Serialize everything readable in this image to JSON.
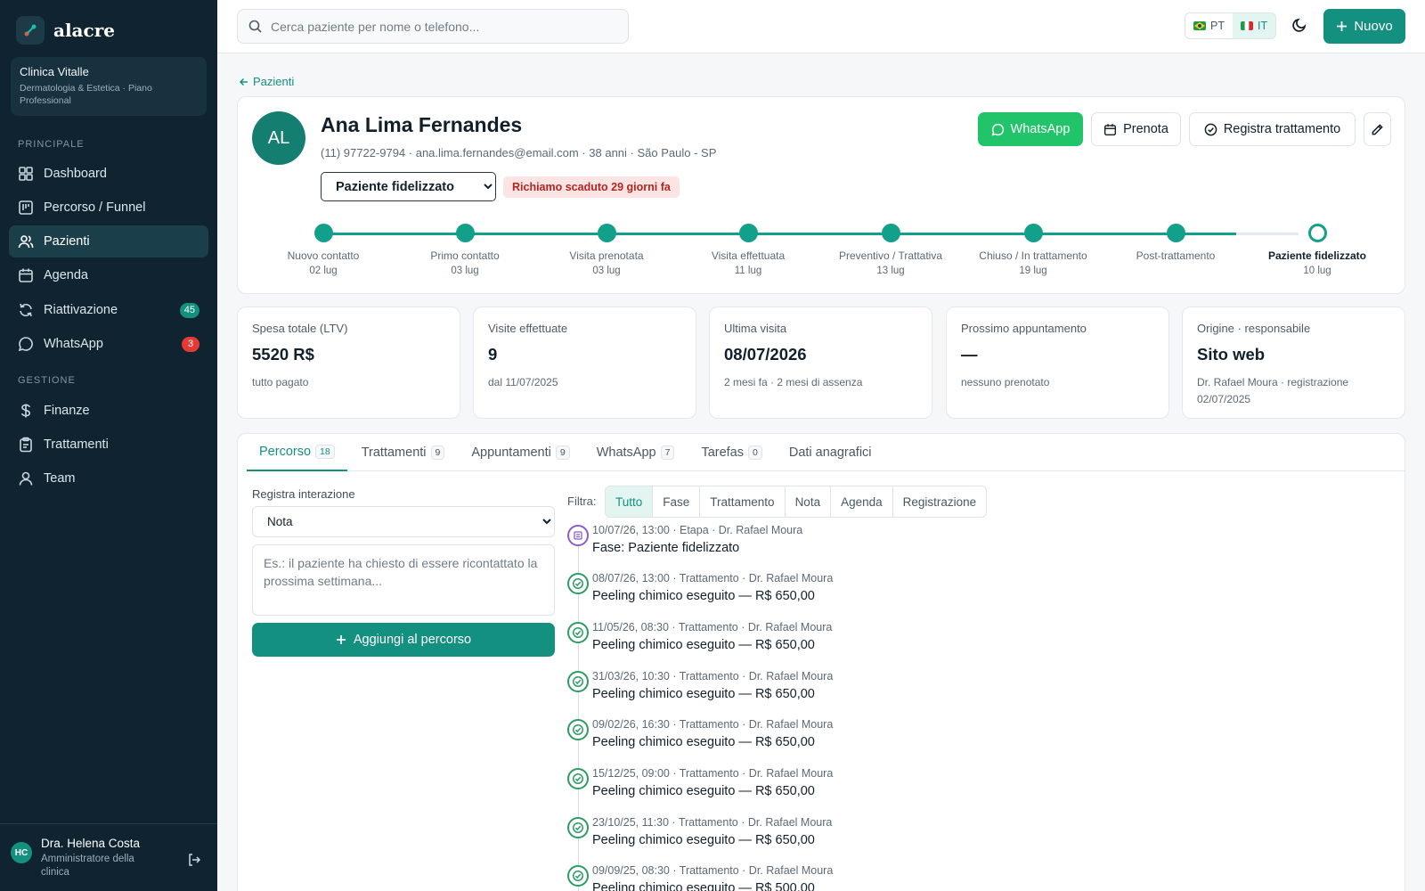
{
  "brand": {
    "name": "alacre"
  },
  "clinic": {
    "name": "Clinica Vitalle",
    "plan": "Dermatologia & Estetica · Piano Professional"
  },
  "sidebar": {
    "section_main": "PRINCIPALE",
    "section_manage": "GESTIONE",
    "items": [
      {
        "label": "Dashboard",
        "icon": "grid-icon"
      },
      {
        "label": "Percorso / Funnel",
        "icon": "funnel-icon"
      },
      {
        "label": "Pazienti",
        "icon": "users-icon",
        "active": true
      },
      {
        "label": "Agenda",
        "icon": "calendar-icon"
      },
      {
        "label": "Riattivazione",
        "icon": "refresh-icon",
        "badge": "45"
      },
      {
        "label": "WhatsApp",
        "icon": "chat-icon",
        "badge": "3"
      },
      {
        "label": "Finanze",
        "icon": "dollar-icon"
      },
      {
        "label": "Trattamenti",
        "icon": "clipboard-icon"
      },
      {
        "label": "Team",
        "icon": "user-icon"
      }
    ]
  },
  "user": {
    "initials": "HC",
    "name": "Dra. Helena Costa",
    "role": "Amministratore della clinica"
  },
  "topbar": {
    "search_placeholder": "Cerca paziente per nome o telefono...",
    "lang_pt": "PT",
    "lang_it": "IT",
    "new_label": "Nuovo"
  },
  "breadcrumb": "Pazienti",
  "patient": {
    "initials": "AL",
    "name": "Ana Lima Fernandes",
    "meta": "(11) 97722-9794 · ana.lima.fernandes@email.com · 38 anni · São Paulo - SP",
    "stage": "Paziente fidelizzato",
    "overdue": "Richiamo scaduto 29 giorni fa",
    "actions": {
      "whatsapp": "WhatsApp",
      "book": "Prenota",
      "register": "Registra trattamento"
    }
  },
  "pipeline": [
    {
      "label": "Nuovo contatto",
      "date": "02 lug"
    },
    {
      "label": "Primo contatto",
      "date": "03 lug"
    },
    {
      "label": "Visita prenotata",
      "date": "03 lug"
    },
    {
      "label": "Visita effettuata",
      "date": "11 lug"
    },
    {
      "label": "Preventivo / Trattativa",
      "date": "13 lug"
    },
    {
      "label": "Chiuso / In trattamento",
      "date": "19 lug"
    },
    {
      "label": "Post-trattamento",
      "date": ""
    },
    {
      "label": "Paziente fidelizzato",
      "date": "10 lug",
      "current": true
    }
  ],
  "stats": [
    {
      "label": "Spesa totale (LTV)",
      "value": "5520 R$",
      "sub": "tutto pagato"
    },
    {
      "label": "Visite effettuate",
      "value": "9",
      "sub": "dal 11/07/2025"
    },
    {
      "label": "Ultima visita",
      "value": "08/07/2026",
      "sub": "2 mesi fa · 2 mesi di assenza"
    },
    {
      "label": "Prossimo appuntamento",
      "value": "—",
      "sub": "nessuno prenotato"
    },
    {
      "label": "Origine · responsabile",
      "value": "Sito web",
      "sub": "Dr. Rafael Moura · registrazione 02/07/2025"
    }
  ],
  "tabs": [
    {
      "label": "Percorso",
      "count": "18",
      "active": true
    },
    {
      "label": "Trattamenti",
      "count": "9"
    },
    {
      "label": "Appuntamenti",
      "count": "9"
    },
    {
      "label": "WhatsApp",
      "count": "7"
    },
    {
      "label": "Tarefas",
      "count": "0"
    },
    {
      "label": "Dati anagrafici",
      "count": ""
    }
  ],
  "interaction": {
    "label": "Registra interazione",
    "type": "Nota",
    "placeholder": "Es.: il paziente ha chiesto di essere ricontattato la prossima settimana...",
    "add_label": "Aggiungi al percorso"
  },
  "filter": {
    "label": "Filtra:",
    "options": [
      "Tutto",
      "Fase",
      "Trattamento",
      "Nota",
      "Agenda",
      "Registrazione"
    ]
  },
  "events": [
    {
      "meta": "10/07/26, 13:00 · Etapa · Dr. Rafael Moura",
      "title": "Fase: Paziente fidelizzato",
      "kind": "stage"
    },
    {
      "meta": "08/07/26, 13:00 · Trattamento · Dr. Rafael Moura",
      "title": "Peeling chimico eseguito — R$ 650,00",
      "kind": "treatment"
    },
    {
      "meta": "11/05/26, 08:30 · Trattamento · Dr. Rafael Moura",
      "title": "Peeling chimico eseguito — R$ 650,00",
      "kind": "treatment"
    },
    {
      "meta": "31/03/26, 10:30 · Trattamento · Dr. Rafael Moura",
      "title": "Peeling chimico eseguito — R$ 650,00",
      "kind": "treatment"
    },
    {
      "meta": "09/02/26, 16:30 · Trattamento · Dr. Rafael Moura",
      "title": "Peeling chimico eseguito — R$ 650,00",
      "kind": "treatment"
    },
    {
      "meta": "15/12/25, 09:00 · Trattamento · Dr. Rafael Moura",
      "title": "Peeling chimico eseguito — R$ 650,00",
      "kind": "treatment"
    },
    {
      "meta": "23/10/25, 11:30 · Trattamento · Dr. Rafael Moura",
      "title": "Peeling chimico eseguito — R$ 650,00",
      "kind": "treatment"
    },
    {
      "meta": "09/09/25, 08:30 · Trattamento · Dr. Rafael Moura",
      "title": "Peeling chimico eseguito — R$ 500,00",
      "kind": "treatment"
    }
  ],
  "colors": {
    "accent": "#13907f",
    "sidebar": "#0f2430",
    "whatsapp": "#22c46a",
    "danger": "#e53935"
  }
}
